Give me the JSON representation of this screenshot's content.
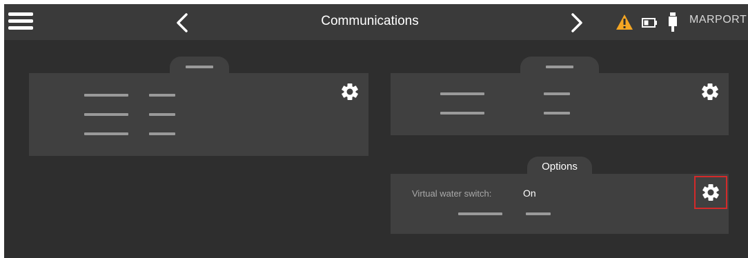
{
  "header": {
    "title": "Communications",
    "menu_icon": "hamburger-menu-icon",
    "prev_icon": "chevron-left-icon",
    "next_icon": "chevron-right-icon",
    "status_icons": [
      "warning-icon",
      "battery-icon",
      "usb-plug-icon"
    ],
    "logo_text": "MARPORT",
    "warning_color": "#f5a623"
  },
  "panels": [
    {
      "tab_label": "",
      "settings_icon": "gear-icon"
    },
    {
      "tab_label": "",
      "settings_icon": "gear-icon"
    },
    {
      "tab_label": "Options",
      "settings_icon": "gear-icon",
      "fields": [
        {
          "label": "Virtual water switch:",
          "value": "On"
        }
      ]
    }
  ],
  "highlight_color": "#d42a2a"
}
